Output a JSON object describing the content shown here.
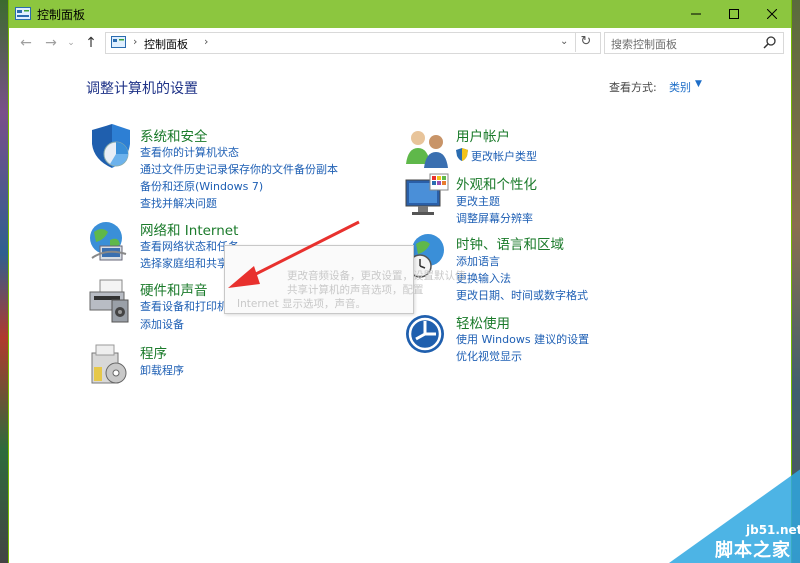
{
  "window": {
    "title": "控制面板"
  },
  "address": {
    "path": "控制面板",
    "separator": "›"
  },
  "search": {
    "placeholder": "搜索控制面板"
  },
  "main": {
    "heading": "调整计算机的设置",
    "view_by_label": "查看方式:",
    "view_by_value": "类别"
  },
  "categories": [
    {
      "title": "系统和安全",
      "links": [
        "查看你的计算机状态",
        "通过文件历史记录保存你的文件备份副本",
        "备份和还原(Windows 7)",
        "查找并解决问题"
      ]
    },
    {
      "title": "网络和 Internet",
      "links": [
        "查看网络状态和任务",
        "选择家庭组和共享选项"
      ]
    },
    {
      "title": "硬件和声音",
      "links": [
        "查看设备和打印机",
        "添加设备"
      ]
    },
    {
      "title": "程序",
      "links": [
        "卸载程序"
      ]
    },
    {
      "title": "用户帐户",
      "links": [
        "更改帐户类型"
      ]
    },
    {
      "title": "外观和个性化",
      "links": [
        "更改主题",
        "调整屏幕分辨率"
      ]
    },
    {
      "title": "时钟、语言和区域",
      "links": [
        "添加语言",
        "更换输入法",
        "更改日期、时间或数字格式"
      ]
    },
    {
      "title": "轻松使用",
      "links": [
        "使用 Windows 建议的设置",
        "优化视觉显示"
      ]
    }
  ],
  "tooltip": {
    "lines": [
      "更改音频设备，更改设置，设置默认值",
      "共享计算机的声音选项，配置",
      "Internet 显示选项，声音。"
    ]
  },
  "watermark": {
    "site": "jb51.net",
    "name": "脚本之家"
  },
  "colors": {
    "titlebar": "#8cc63f",
    "link": "#1e5fb4",
    "category_title": "#1a7a2a",
    "heading": "#1e3287",
    "arrow": "#e8312e"
  }
}
